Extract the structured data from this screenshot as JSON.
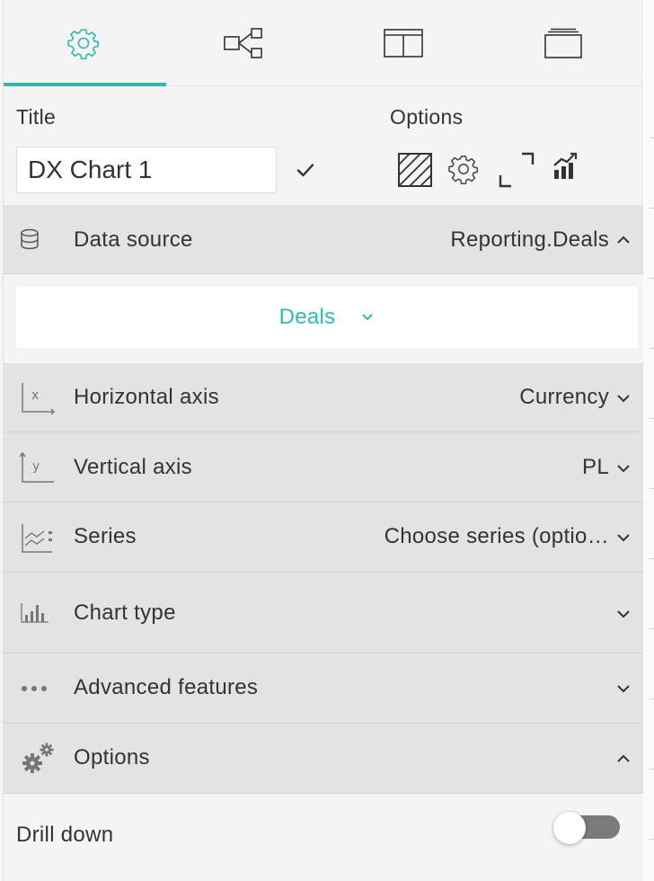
{
  "tabs": [
    {
      "icon": "gear-icon",
      "active": true
    },
    {
      "icon": "flow-icon",
      "active": false
    },
    {
      "icon": "layout-icon",
      "active": false
    },
    {
      "icon": "stack-icon",
      "active": false
    }
  ],
  "header": {
    "title_label": "Title",
    "options_label": "Options",
    "title_value": "DX Chart 1",
    "option_icons": [
      "hatch-pattern-icon",
      "gear-icon",
      "expand-icon",
      "chart-trend-icon"
    ]
  },
  "rows": {
    "data_source": {
      "label": "Data source",
      "value": "Reporting.Deals",
      "icon": "database-icon",
      "expanded": true
    },
    "deals": {
      "label": "Deals"
    },
    "horizontal_axis": {
      "label": "Horizontal axis",
      "value": "Currency",
      "icon": "x-axis-icon"
    },
    "vertical_axis": {
      "label": "Vertical axis",
      "value": "PL",
      "icon": "y-axis-icon"
    },
    "series": {
      "label": "Series",
      "value": "Choose series (optio…",
      "icon": "series-icon"
    },
    "chart_type": {
      "label": "Chart type",
      "value": "",
      "icon": "bar-chart-icon"
    },
    "advanced": {
      "label": "Advanced features",
      "value": "",
      "icon": "more-dots-icon"
    },
    "options": {
      "label": "Options",
      "value": "",
      "icon": "gears-icon",
      "expanded": true
    }
  },
  "drill_down": {
    "label": "Drill down",
    "enabled": false
  },
  "colors": {
    "accent": "#2bbbb0",
    "row_bg": "#e3e3e3",
    "panel_bg": "#f4f4f4"
  }
}
